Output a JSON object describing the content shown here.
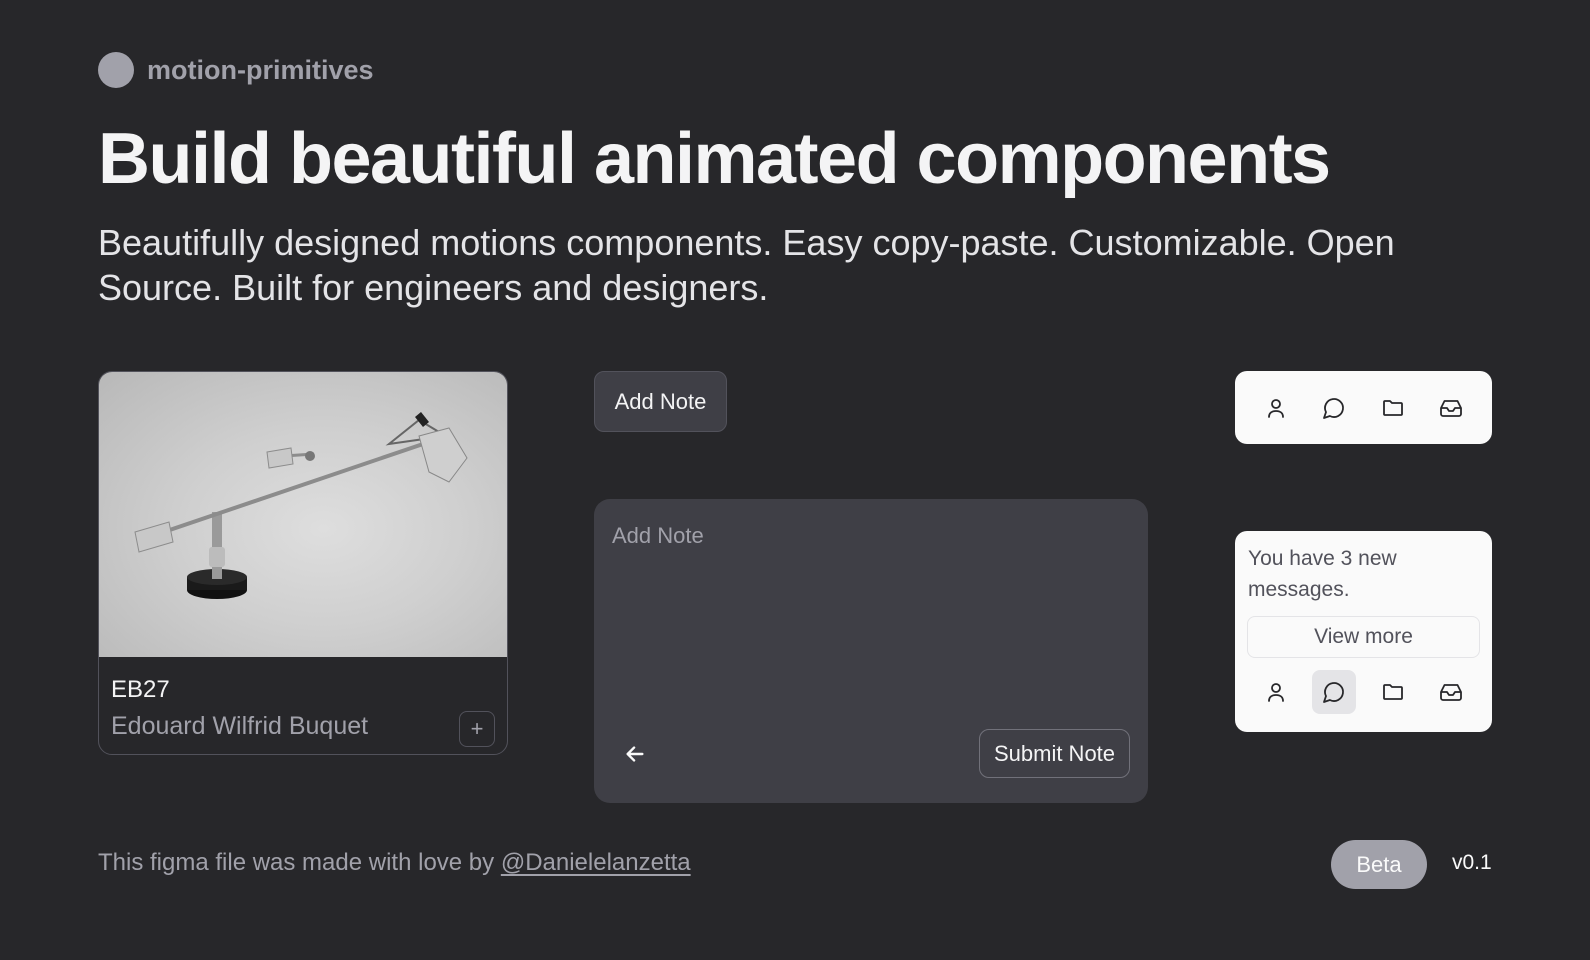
{
  "brand": {
    "name": "motion-primitives"
  },
  "hero": {
    "title": "Build beautiful animated components",
    "subtitle": "Beautifully designed motions components. Easy copy-paste. Customizable. Open Source. Built for engineers and designers."
  },
  "product_card": {
    "code": "EB27",
    "maker": "Edouard Wilfrid Buquet",
    "add_label": "+"
  },
  "add_note_button": {
    "label": "Add Note"
  },
  "note_panel": {
    "placeholder": "Add Note",
    "value": "",
    "submit_label": "Submit Note",
    "back_icon": "arrow-left-icon"
  },
  "toolbar": {
    "icons": [
      "user-icon",
      "message-circle-icon",
      "folder-icon",
      "inbox-icon"
    ]
  },
  "toolbar_expanded": {
    "message": "You have 3 new messages.",
    "view_more_label": "View more",
    "active_icon": "message-circle-icon"
  },
  "footer": {
    "prefix": "This figma file was made with love by ",
    "link_text": "@Danielelanzetta",
    "badge": "Beta",
    "version": "v0.1"
  },
  "colors": {
    "background": "#27272a",
    "panel": "#3f3f46",
    "light_surface": "#fafafa",
    "muted": "#a1a1aa"
  }
}
